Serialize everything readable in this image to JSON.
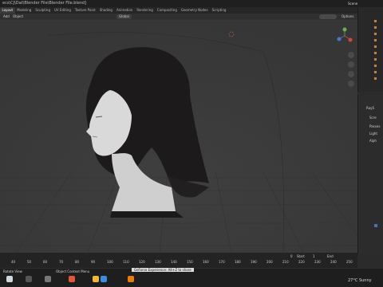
{
  "window": {
    "title": "ecs\\CJ\\Dat\\Blender File\\Blender File.blend]"
  },
  "workspace_tabs": [
    {
      "label": "Layout",
      "active": true
    },
    {
      "label": "Modeling",
      "active": false
    },
    {
      "label": "Sculpting",
      "active": false
    },
    {
      "label": "UV Editing",
      "active": false
    },
    {
      "label": "Texture Paint",
      "active": false
    },
    {
      "label": "Shading",
      "active": false
    },
    {
      "label": "Animation",
      "active": false
    },
    {
      "label": "Rendering",
      "active": false
    },
    {
      "label": "Compositing",
      "active": false
    },
    {
      "label": "Geometry Nodes",
      "active": false
    },
    {
      "label": "Scripting",
      "active": false
    }
  ],
  "viewport_header": {
    "menu_add": "Add",
    "menu_object": "Object",
    "orientation": "Global",
    "options": "Options"
  },
  "scene": {
    "label": "Scene"
  },
  "properties": {
    "lines": [
      "RayS",
      "Scre",
      "Passes",
      "Light",
      "Alph"
    ]
  },
  "timeline": {
    "ticks": [
      "40",
      "50",
      "60",
      "70",
      "80",
      "90",
      "100",
      "110",
      "120",
      "130",
      "140",
      "150",
      "160",
      "170",
      "180",
      "190",
      "200",
      "210",
      "220",
      "230",
      "240",
      "250"
    ],
    "start_label": "Start",
    "start_value": "1",
    "end_label": "End",
    "current_frame": "0"
  },
  "status_bar": {
    "left": "Rotate View",
    "middle": "Object Context Menu",
    "tooltip": "GeForce Experience: Alt+Z to share"
  },
  "taskbar": {
    "weather": "27°C  Sunny",
    "time_line1": "",
    "time_line2": ""
  },
  "colors": {
    "accent": "#4772b3",
    "bg": "#3b3b3b",
    "panel": "#2b2b2b"
  },
  "icons": [
    "camera-icon",
    "hand-icon",
    "zoom-icon",
    "grid-icon",
    "gizmo-axes"
  ]
}
